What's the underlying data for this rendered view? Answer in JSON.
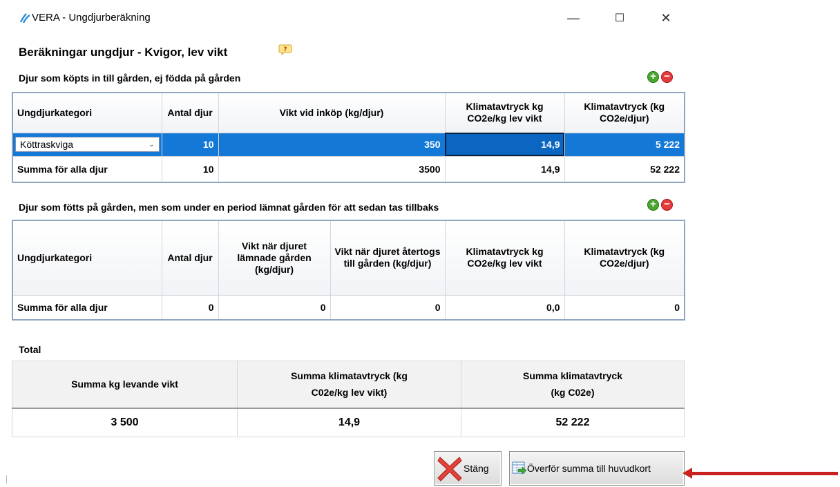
{
  "window": {
    "title": "VERA - Ungdjurberäkning",
    "controls": {
      "minimize": "—",
      "maximize": "☐",
      "close": "✕"
    }
  },
  "heading": "Beräkningar ungdjur - Kvigor, lev vikt",
  "section1": {
    "title": "Djur som köpts in till gården, ej födda på gården",
    "headers": [
      "Ungdjurkategori",
      "Antal djur",
      "Vikt vid inköp (kg/djur)",
      "Klimatavtryck kg CO2e/kg lev vikt",
      "Klimatavtryck (kg CO2e/djur)"
    ],
    "row": {
      "category": "Köttraskviga",
      "count": "10",
      "weight": "350",
      "climate_per_kg": "14,9",
      "climate_per_animal": "5 222"
    },
    "sum": {
      "label": "Summa för alla djur",
      "count": "10",
      "weight": "3500",
      "climate_per_kg": "14,9",
      "climate_per_animal": "52 222"
    }
  },
  "section2": {
    "title": "Djur som fötts på gården, men som under en period lämnat gården för att sedan tas tillbaks",
    "headers": [
      "Ungdjurkategori",
      "Antal djur",
      "Vikt när djuret lämnade gården (kg/djur)",
      "Vikt när djuret återtogs till gården (kg/djur)",
      "Klimatavtryck kg CO2e/kg lev vikt",
      "Klimatavtryck (kg CO2e/djur)"
    ],
    "sum": {
      "label": "Summa för alla djur",
      "count": "0",
      "weight_left": "0",
      "weight_back": "0",
      "climate_per_kg": "0,0",
      "climate_per_animal": "0"
    }
  },
  "total": {
    "title": "Total",
    "headers": [
      "Summa kg levande vikt",
      "Summa klimatavtryck (kg C02e/kg lev vikt)",
      "Summa klimatavtryck (kg C02e)"
    ],
    "values": [
      "3 500",
      "14,9",
      "52 222"
    ]
  },
  "buttons": {
    "close": "Stäng",
    "transfer": "Överför summa till huvudkort"
  },
  "colors": {
    "selection": "#1479d6",
    "arrow": "#c8231e",
    "plus": "#4aa531",
    "minus": "#e23c3c"
  }
}
